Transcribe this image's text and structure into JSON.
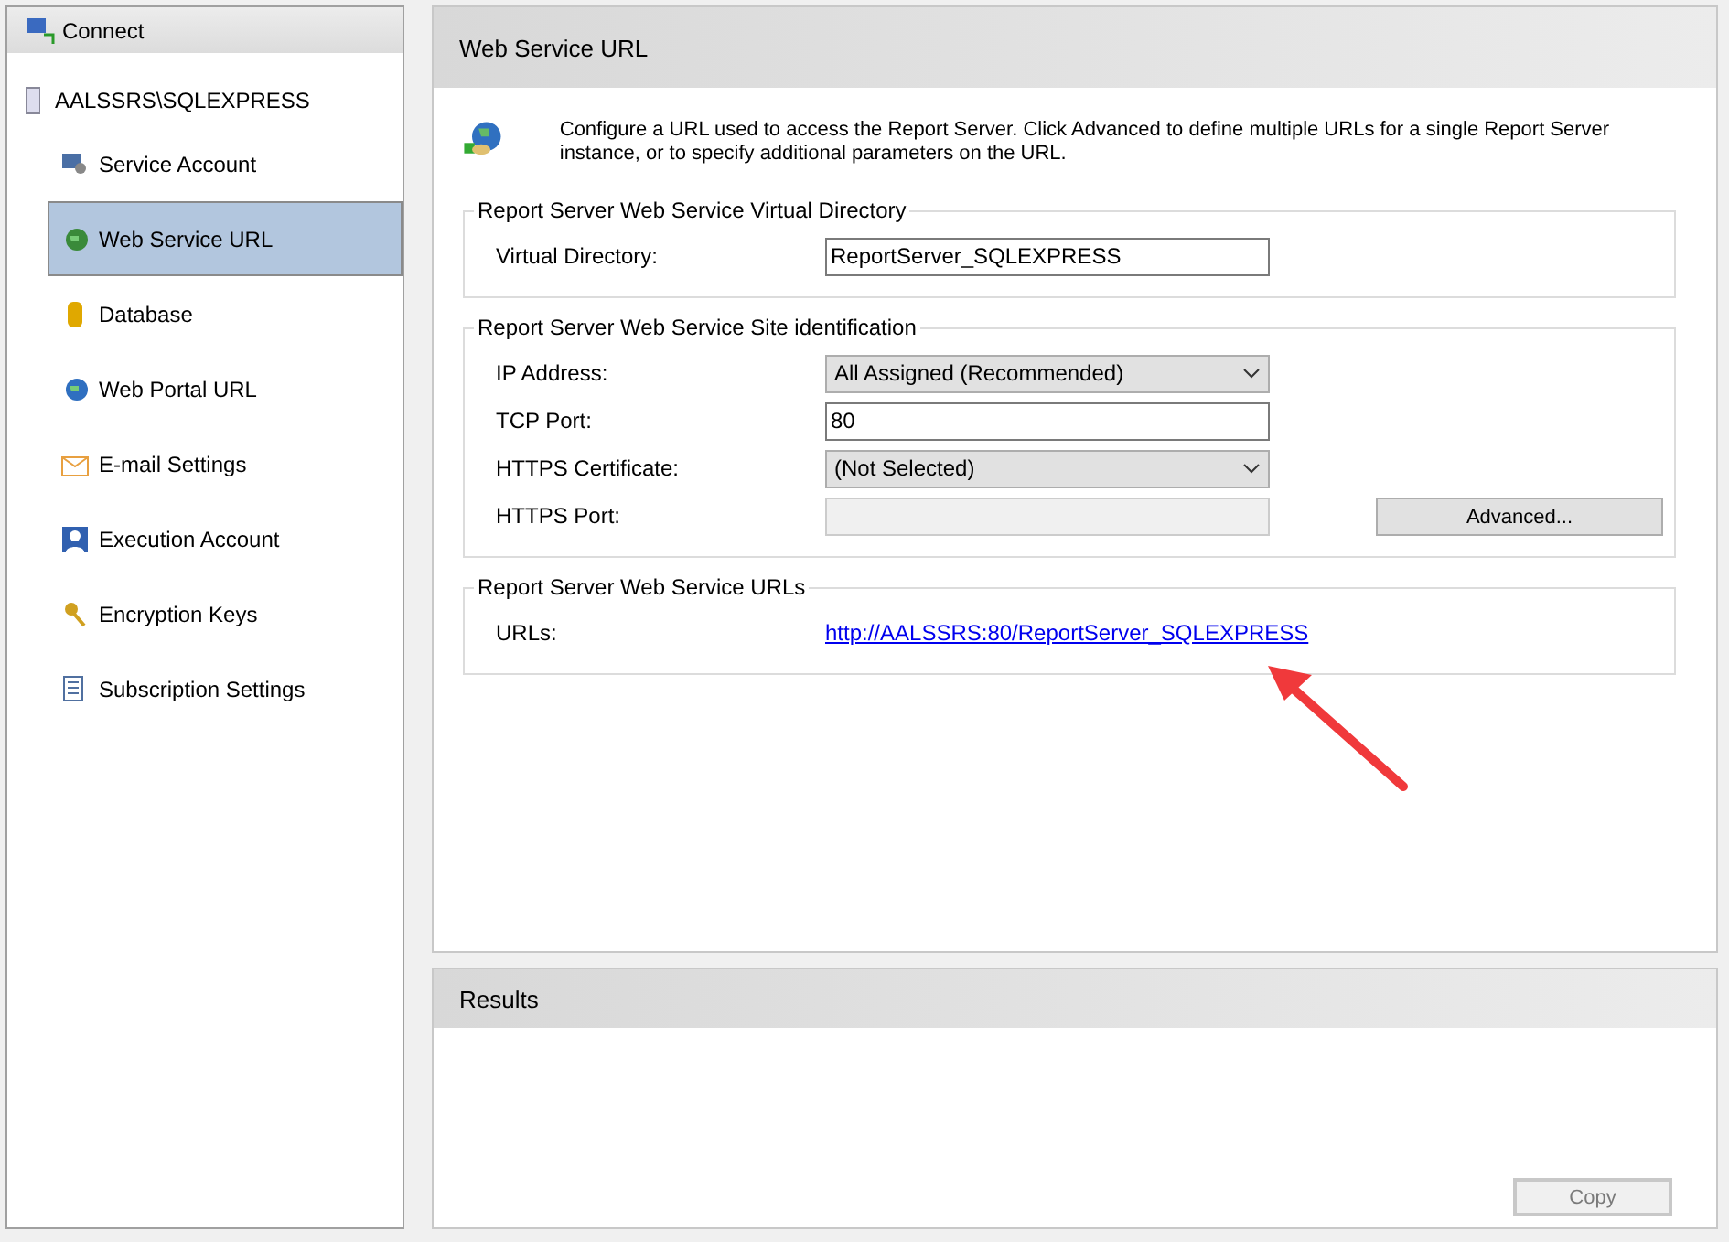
{
  "sidebar": {
    "connect": "Connect",
    "server": "AALSSRS\\SQLEXPRESS",
    "items": [
      {
        "label": "Service Account",
        "selected": false
      },
      {
        "label": "Web Service URL",
        "selected": true
      },
      {
        "label": "Database",
        "selected": false
      },
      {
        "label": "Web Portal URL",
        "selected": false
      },
      {
        "label": "E-mail Settings",
        "selected": false
      },
      {
        "label": "Execution Account",
        "selected": false
      },
      {
        "label": "Encryption Keys",
        "selected": false
      },
      {
        "label": "Subscription Settings",
        "selected": false
      }
    ]
  },
  "main": {
    "title": "Web Service URL",
    "description": "Configure a URL used to access the Report Server.  Click Advanced to define multiple URLs for a single Report Server instance, or to specify additional parameters on the URL.",
    "groups": [
      {
        "title": "Report Server Web Service Virtual Directory",
        "fields": [
          {
            "label": "Virtual Directory:",
            "kind": "text",
            "value": "ReportServer_SQLEXPRESS"
          }
        ]
      },
      {
        "title": "Report Server Web Service Site identification",
        "fields": [
          {
            "label": "IP Address:",
            "kind": "select",
            "value": "All Assigned (Recommended)"
          },
          {
            "label": "TCP Port:",
            "kind": "text",
            "value": "80"
          },
          {
            "label": "HTTPS Certificate:",
            "kind": "select",
            "value": "(Not Selected)"
          },
          {
            "label": "HTTPS Port:",
            "kind": "disabled"
          }
        ],
        "button": "Advanced..."
      },
      {
        "title": "Report Server Web Service URLs",
        "fields": [
          {
            "label": "URLs:",
            "kind": "link",
            "value": "http://AALSSRS:80/ReportServer_SQLEXPRESS"
          }
        ]
      }
    ]
  },
  "results": {
    "title": "Results",
    "copy": {
      "label": "Copy",
      "disabled": true
    }
  }
}
